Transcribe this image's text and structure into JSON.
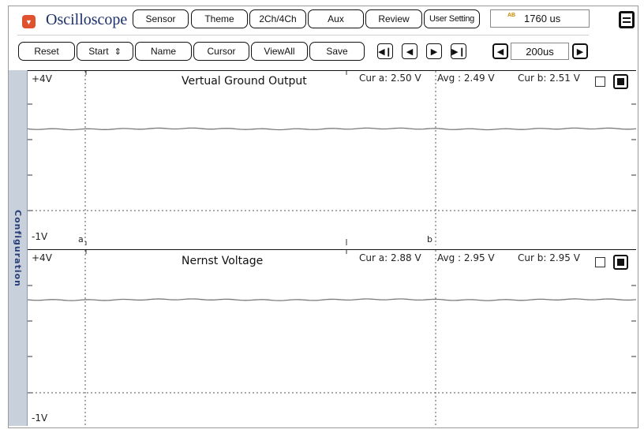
{
  "app": {
    "title": "Oscilloscope",
    "time_display": "1760 us",
    "time_icon_text": "AB"
  },
  "topbar": {
    "tabs": [
      {
        "label": "Sensor"
      },
      {
        "label": "Theme"
      },
      {
        "label": "2Ch/4Ch"
      },
      {
        "label": "Aux"
      },
      {
        "label": "Review"
      },
      {
        "label": "User Setting"
      }
    ]
  },
  "toolbar": {
    "reset": "Reset",
    "start": "Start",
    "name": "Name",
    "cursor": "Cursor",
    "viewall": "ViewAll",
    "save": "Save",
    "zoom_value": "200us",
    "nav_icons": [
      "skip-start-icon",
      "step-back-icon",
      "play-icon",
      "skip-end-icon"
    ]
  },
  "sidebar": {
    "label": "Configuration"
  },
  "channels": [
    {
      "title": "Vertual Ground Output",
      "ymax_label": "+4V",
      "ymin_label": "-1V",
      "cur_a": "Cur a: 2.50 V",
      "avg": "Avg  : 2.49 V",
      "cur_b": "Cur b: 2.51 V",
      "cursor_a_label": "a",
      "cursor_b_label": "b",
      "trace_level": 2.5
    },
    {
      "title": "Nernst Voltage",
      "ymax_label": "+4V",
      "ymin_label": "-1V",
      "cur_a": "Cur a: 2.88 V",
      "avg": "Avg  : 2.95 V",
      "cur_b": "Cur b: 2.95 V",
      "trace_level": 2.95
    }
  ],
  "colors": {
    "title_color": "#1a2f6b",
    "app_icon": "#e0522e",
    "sidebar_bg": "#c8d0dc",
    "trace": "#7a7a7a"
  }
}
